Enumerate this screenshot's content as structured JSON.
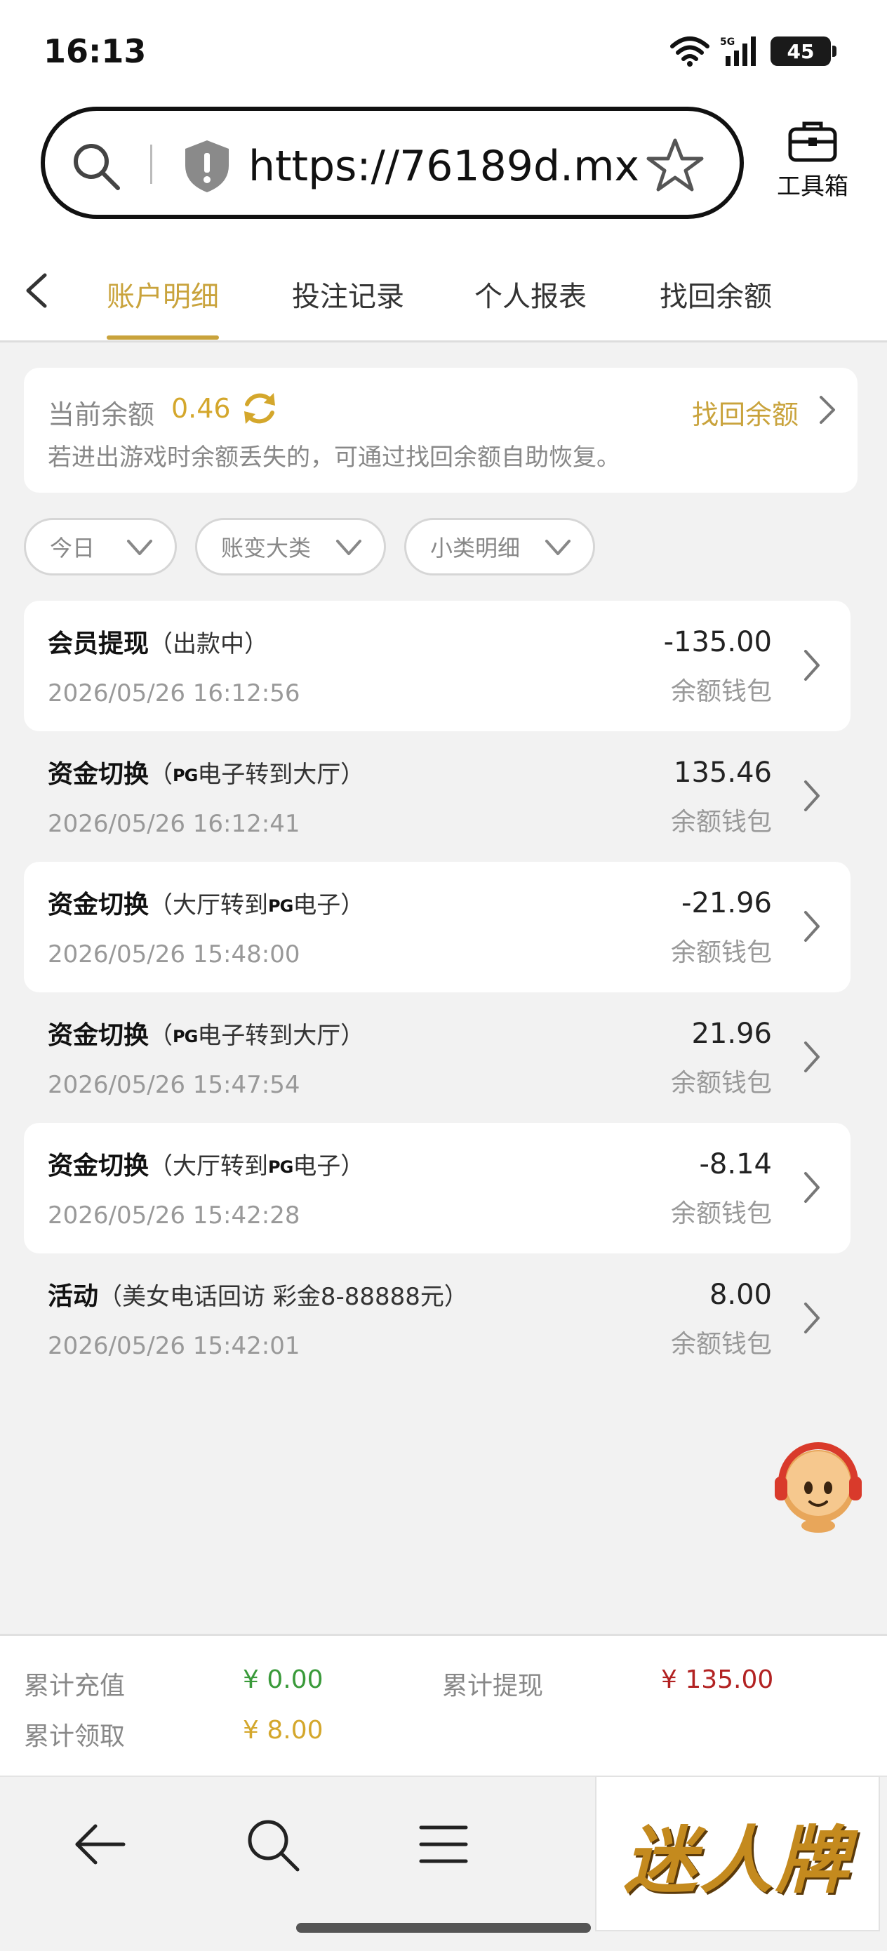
{
  "status": {
    "time": "16:13",
    "network": "5G",
    "battery": "45"
  },
  "browser": {
    "url": "https://76189d.mx...",
    "toolbox_label": "工具箱"
  },
  "tabs": [
    {
      "label": "账户明细",
      "active": true
    },
    {
      "label": "投注记录"
    },
    {
      "label": "个人报表"
    },
    {
      "label": "找回余额"
    }
  ],
  "balance": {
    "label": "当前余额",
    "value": "0.46",
    "recover_label": "找回余额",
    "hint": "若进出游戏时余额丢失的，可通过找回余额自助恢复。"
  },
  "filters": [
    {
      "label": "今日"
    },
    {
      "label": "账变大类"
    },
    {
      "label": "小类明细"
    }
  ],
  "transactions": [
    {
      "title": "会员提现",
      "detail_pre": "（出款中）",
      "pg": "",
      "detail_post": "",
      "date": "2026/05/26 16:12:56",
      "amount": "-135.00",
      "wallet": "余额钱包"
    },
    {
      "title": "资金切换",
      "detail_pre": "（",
      "pg": "PG",
      "detail_post": "电子转到大厅）",
      "date": "2026/05/26 16:12:41",
      "amount": "135.46",
      "wallet": "余额钱包"
    },
    {
      "title": "资金切换",
      "detail_pre": "（大厅转到",
      "pg": "PG",
      "detail_post": "电子）",
      "date": "2026/05/26 15:48:00",
      "amount": "-21.96",
      "wallet": "余额钱包"
    },
    {
      "title": "资金切换",
      "detail_pre": "（",
      "pg": "PG",
      "detail_post": "电子转到大厅）",
      "date": "2026/05/26 15:47:54",
      "amount": "21.96",
      "wallet": "余额钱包"
    },
    {
      "title": "资金切换",
      "detail_pre": "（大厅转到",
      "pg": "PG",
      "detail_post": "电子）",
      "date": "2026/05/26 15:42:28",
      "amount": "-8.14",
      "wallet": "余额钱包"
    },
    {
      "title": "活动",
      "detail_pre": "（美女电话回访 彩金8-88888元）",
      "pg": "",
      "detail_post": "",
      "date": "2026/05/26 15:42:01",
      "amount": "8.00",
      "wallet": "余额钱包"
    }
  ],
  "summary": {
    "recharge_label": "累计充值",
    "recharge_value": "¥ 0.00",
    "withdraw_label": "累计提现",
    "withdraw_value": "¥ 135.00",
    "claim_label": "累计领取",
    "claim_value": "¥ 8.00"
  },
  "colors": {
    "accent": "#c9a33c",
    "green": "#3a9a3a",
    "red": "#b22222",
    "gold": "#d4a72c"
  },
  "brand": {
    "text": "迷人牌"
  }
}
